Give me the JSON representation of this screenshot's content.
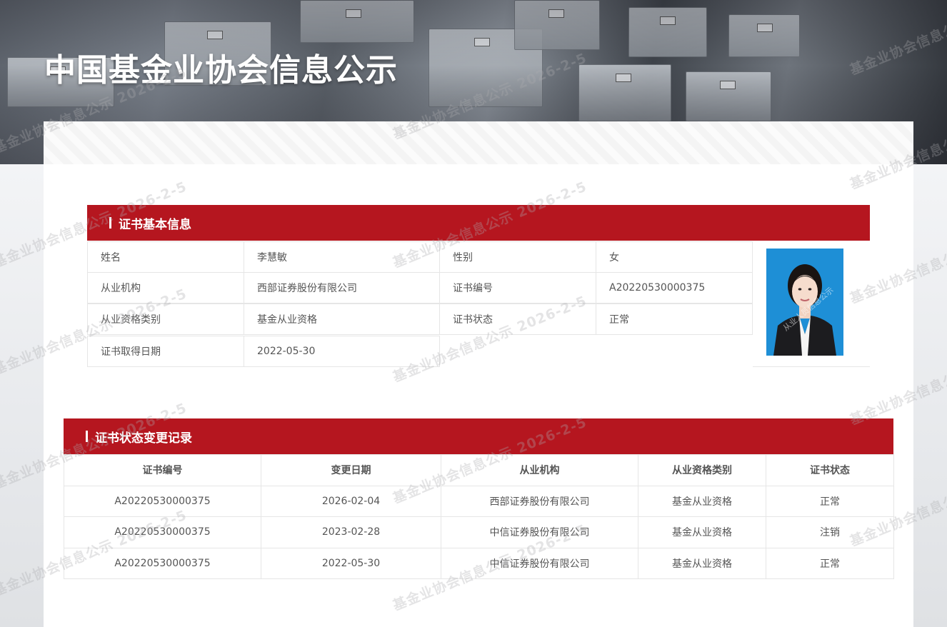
{
  "page": {
    "title": "中国基金业协会信息公示"
  },
  "basic_info": {
    "section_title": "证书基本信息",
    "rows": [
      [
        {
          "label": "姓名"
        },
        {
          "value": "李慧敏"
        },
        {
          "label": "性别"
        },
        {
          "value": "女"
        }
      ],
      [
        {
          "label": "从业机构"
        },
        {
          "value": "西部证券股份有限公司"
        },
        {
          "label": "证书编号"
        },
        {
          "value": "A20220530000375"
        }
      ],
      [
        {
          "label": "从业资格类别"
        },
        {
          "value": "基金从业资格"
        },
        {
          "label": "证书状态"
        },
        {
          "value": "正常"
        }
      ],
      [
        {
          "label": "证书取得日期"
        },
        {
          "value": "2022-05-30"
        }
      ]
    ],
    "photo_watermark": "从业人员信息公示"
  },
  "change_records": {
    "section_title": "证书状态变更记录",
    "columns": [
      "证书编号",
      "变更日期",
      "从业机构",
      "从业资格类别",
      "证书状态"
    ],
    "rows": [
      [
        "A20220530000375",
        "2026-02-04",
        "西部证券股份有限公司",
        "基金从业资格",
        "正常"
      ],
      [
        "A20220530000375",
        "2023-02-28",
        "中信证券股份有限公司",
        "基金从业资格",
        "注销"
      ],
      [
        "A20220530000375",
        "2022-05-30",
        "中信证券股份有限公司",
        "基金从业资格",
        "正常"
      ]
    ]
  },
  "watermark": {
    "text": "基金业协会信息公示 2026-2-5"
  },
  "colors": {
    "accent": "#b5161f",
    "photo_background": "#1e8fd6"
  }
}
